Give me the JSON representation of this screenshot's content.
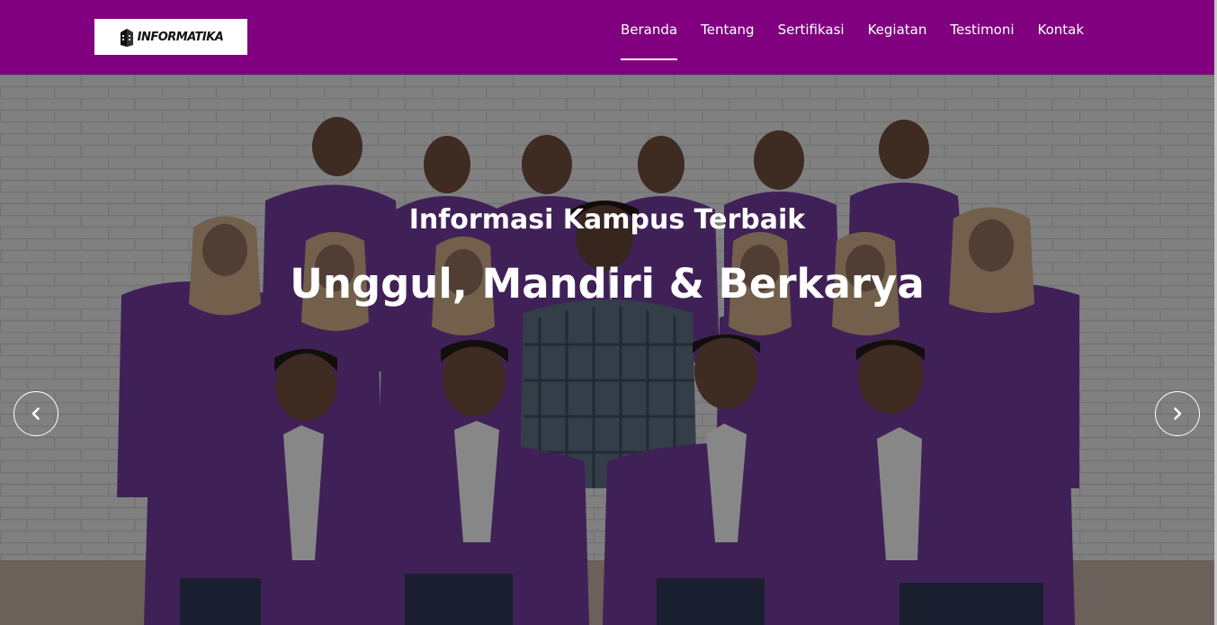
{
  "colors": {
    "navbar_bg": "#800080",
    "nav_text": "#ffffff",
    "hero_text": "#ffffff",
    "jacket": "#6f3a96",
    "wall": "#d8d9db"
  },
  "brand": {
    "logo_text": "INFORMATIKA",
    "logo_icon": "building-logo-icon"
  },
  "nav": {
    "items": [
      {
        "label": "Beranda",
        "active": true
      },
      {
        "label": "Tentang",
        "active": false
      },
      {
        "label": "Sertifikasi",
        "active": false
      },
      {
        "label": "Kegiatan",
        "active": false
      },
      {
        "label": "Testimoni",
        "active": false
      },
      {
        "label": "Kontak",
        "active": false
      }
    ]
  },
  "hero": {
    "subtitle": "Informasi Kampus Terbaik",
    "title": "Unggul, Mandiri & Berkarya",
    "image_subject": "group photo of students in purple jackets",
    "controls": {
      "prev_icon": "chevron-left-icon",
      "next_icon": "chevron-right-icon"
    }
  }
}
